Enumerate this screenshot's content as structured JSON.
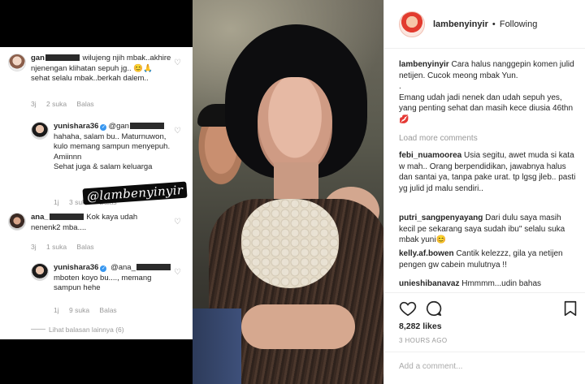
{
  "left_screenshot": {
    "comments": [
      {
        "username_prefix": "gan",
        "text": "wilujeng njih mbak..akhire njenengan klihatan sepuh jg.. 😊🙏 sehat selalu mbak..berkah dalem..",
        "time": "3j",
        "likes": "2 suka",
        "reply": "Balas"
      },
      {
        "username": "yunishara36",
        "mention_prefix": "@gan",
        "text": "hahaha, salam bu.. Maturnuwon, kulo memang sampun menyepuh. Amiinnn\nSehat juga & salam keluarga",
        "time": "1j",
        "likes": "3 suka",
        "reply": "Balas"
      },
      {
        "username_prefix": "ana_",
        "text": "Kok kaya udah nenenk2 mba....",
        "time": "3j",
        "likes": "1 suka",
        "reply": "Balas"
      },
      {
        "username": "yunishara36",
        "mention_prefix": "@ana_",
        "text": "mboten koyo bu...., memang sampun hehe",
        "time": "1j",
        "likes": "9 suka",
        "reply": "Balas"
      }
    ],
    "watermark": "@lambenyinyir",
    "more_replies": "Lihat balasan lainnya (6)"
  },
  "post": {
    "author": "lambenyinyir",
    "separator": "•",
    "follow_status": "Following",
    "caption": "Cara halus nanggepin komen julid netijen. Cucok meong mbak Yun.\n.\nEmang udah jadi nenek dan udah sepuh yes, yang penting sehat dan masih kece diusia 46thn💋",
    "load_more": "Load more comments",
    "comments": [
      {
        "user": "febi_nuamoorea",
        "text": "Usia segitu, awet muda si kata w mah.. Orang berpendidikan, jawabnya halus dan santai ya, tanpa pake urat. tp lgsg jleb.. pasti yg julid jd malu sendiri.."
      },
      {
        "user": "putri_sangpenyayang",
        "text": "Dari dulu saya masih kecil pe sekarang saya sudah ibu\" selalu suka mbak yuni😊"
      },
      {
        "user": "kelly.af.bowen",
        "text": "Cantik kelezzz, gila ya netijen pengen gw cabein mulutnya !!"
      },
      {
        "user": "unieshibanavaz",
        "text": "Hmmmm...udin bahas"
      }
    ],
    "likes": "8,282 likes",
    "time": "3 HOURS AGO",
    "add_comment_placeholder": "Add a comment..."
  },
  "icons": {
    "heart": "heart-icon",
    "comment": "comment-icon",
    "bookmark": "bookmark-icon",
    "verified": "verified-badge-icon"
  }
}
